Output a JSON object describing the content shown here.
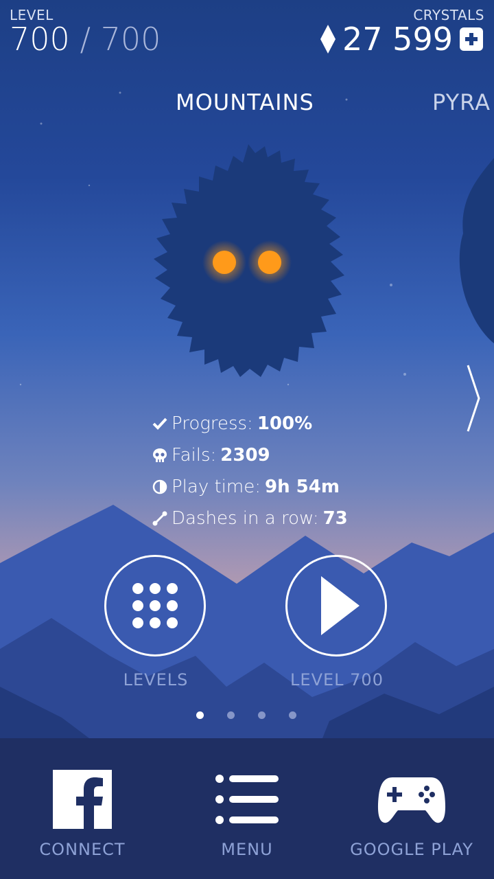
{
  "hud": {
    "level_label": "LEVEL",
    "level_current": "700",
    "level_separator": "/",
    "level_max": "700",
    "crystals_label": "CRYSTALS",
    "crystals_value": "27 599"
  },
  "worlds": {
    "current": "MOUNTAINS",
    "next_partial": "PYRA"
  },
  "stats": {
    "progress_label": "Progress:",
    "progress_value": "100%",
    "fails_label": "Fails:",
    "fails_value": "2309",
    "playtime_label": "Play time:",
    "playtime_value": "9h 54m",
    "dashes_label": "Dashes in a row:",
    "dashes_value": "73"
  },
  "buttons": {
    "levels_label": "LEVELS",
    "play_label": "LEVEL 700"
  },
  "pager": {
    "total": 4,
    "active": 1
  },
  "bottom_bar": {
    "connect_label": "CONNECT",
    "menu_label": "MENU",
    "google_play_label": "GOOGLE PLAY"
  },
  "icons": [
    "diamond-icon",
    "plus-icon",
    "check-icon",
    "skull-icon",
    "clock-icon",
    "dash-icon",
    "grid-icon",
    "play-icon",
    "facebook-icon",
    "menu-icon",
    "gamepad-icon",
    "chevron-right-icon"
  ],
  "colors": {
    "eyes": "#ff9a1a",
    "monster": "#1b3a7a",
    "bottom_bar": "#1f2f63",
    "label_muted": "#8ea2d6"
  }
}
